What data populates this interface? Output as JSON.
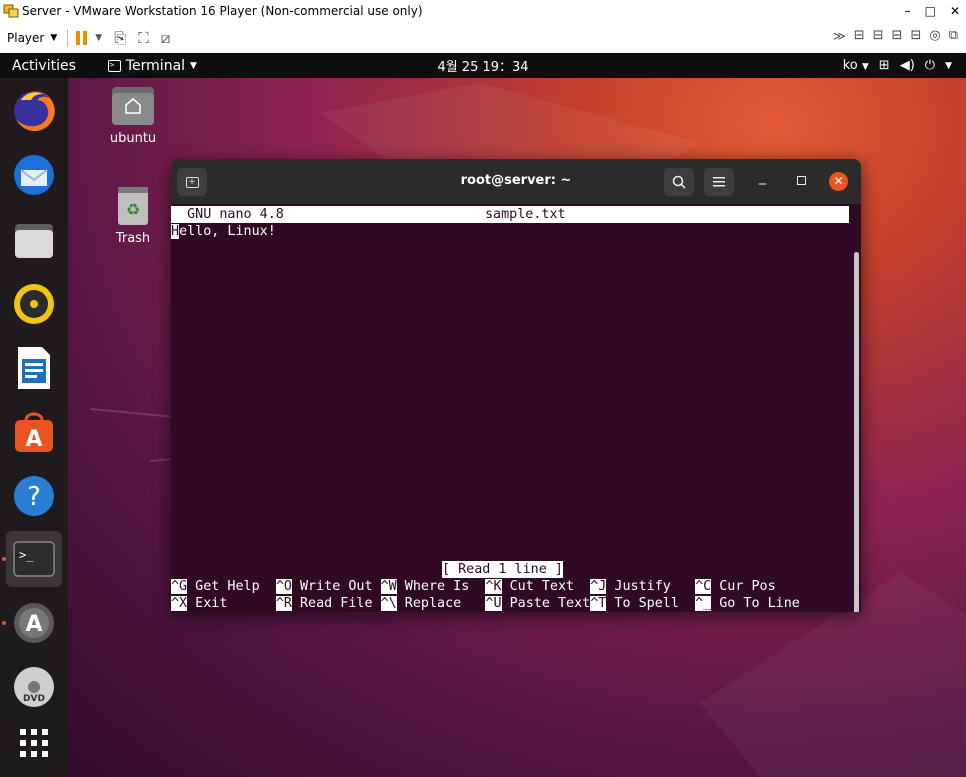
{
  "vmware": {
    "title": "Server - VMware Workstation 16 Player (Non-commercial use only)",
    "player_menu": "Player",
    "window_controls": [
      "minimize-icon",
      "maximize-icon",
      "close-icon"
    ]
  },
  "gnome": {
    "activities": "Activities",
    "app_menu": "Terminal",
    "clock": "4월 25  19：34",
    "keyboard": "ko"
  },
  "desktop": {
    "icons": [
      {
        "label": "ubuntu",
        "icon": "home-folder-icon"
      },
      {
        "label": "Trash",
        "icon": "trash-icon"
      }
    ]
  },
  "dock": {
    "items": [
      "firefox-icon",
      "thunderbird-icon",
      "files-icon",
      "rhythmbox-icon",
      "libreoffice-writer-icon",
      "software-center-icon",
      "help-icon",
      "terminal-icon",
      "software-updater-icon",
      "dvd-icon",
      "show-apps-icon"
    ]
  },
  "terminal": {
    "title": "root@server: ~",
    "nano_header_left": "  GNU nano 4.8",
    "nano_header_file": "sample.txt",
    "cursor_char": "H",
    "content_rest": "ello, Linux!",
    "status": "[ Read 1 line ]",
    "shortcuts_row1": [
      {
        "key": "^G",
        "label": " Get Help  "
      },
      {
        "key": "^O",
        "label": " Write Out "
      },
      {
        "key": "^W",
        "label": " Where Is  "
      },
      {
        "key": "^K",
        "label": " Cut Text  "
      },
      {
        "key": "^J",
        "label": " Justify   "
      },
      {
        "key": "^C",
        "label": " Cur Pos"
      }
    ],
    "shortcuts_row2": [
      {
        "key": "^X",
        "label": " Exit      "
      },
      {
        "key": "^R",
        "label": " Read File "
      },
      {
        "key": "^\\",
        "label": " Replace   "
      },
      {
        "key": "^U",
        "label": " Paste Text"
      },
      {
        "key": "^T",
        "label": " To Spell  "
      },
      {
        "key": "^_",
        "label": " Go To Line"
      }
    ]
  }
}
